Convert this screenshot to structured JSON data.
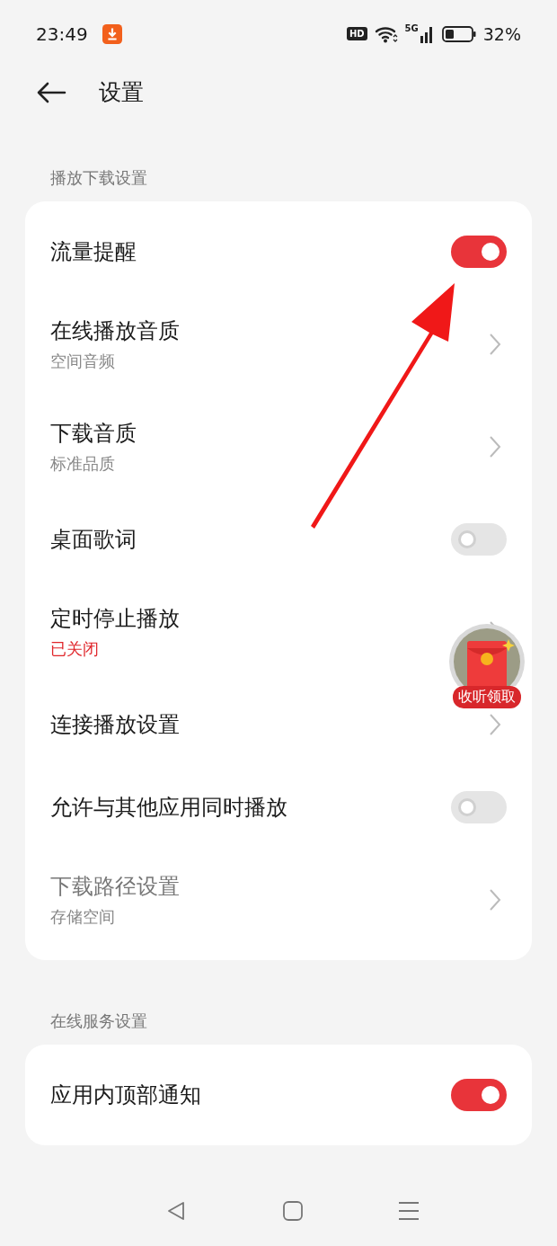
{
  "status_bar": {
    "time": "23:49",
    "hd": "HD",
    "network": "5G",
    "battery": "32%"
  },
  "header": {
    "title": "设置"
  },
  "sections": [
    {
      "title": "播放下载设置",
      "rows": [
        {
          "kind": "toggle",
          "label": "流量提醒",
          "on": true,
          "disabled": false
        },
        {
          "kind": "link",
          "label": "在线播放音质",
          "subtitle": "空间音频",
          "highlight": false,
          "disabled": false
        },
        {
          "kind": "link",
          "label": "下载音质",
          "subtitle": "标准品质",
          "highlight": false,
          "disabled": false
        },
        {
          "kind": "toggle",
          "label": "桌面歌词",
          "on": false,
          "disabled": false
        },
        {
          "kind": "link",
          "label": "定时停止播放",
          "subtitle": "已关闭",
          "highlight": true,
          "disabled": false
        },
        {
          "kind": "link",
          "label": "连接播放设置",
          "disabled": false
        },
        {
          "kind": "toggle",
          "label": "允许与其他应用同时播放",
          "on": false,
          "disabled": false
        },
        {
          "kind": "link",
          "label": "下载路径设置",
          "subtitle": "存储空间",
          "highlight": false,
          "disabled": true
        }
      ]
    },
    {
      "title": "在线服务设置",
      "rows": [
        {
          "kind": "toggle",
          "label": "应用内顶部通知",
          "on": true,
          "disabled": false
        }
      ]
    }
  ],
  "floating_badge": {
    "label": "收听领取"
  }
}
